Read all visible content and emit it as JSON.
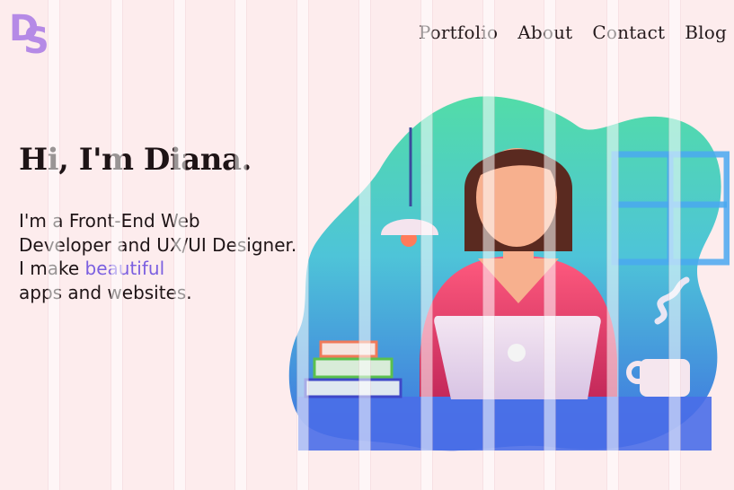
{
  "logo": {
    "letter_1": "D",
    "letter_2": "S"
  },
  "nav": {
    "items": [
      "Portfolio",
      "About",
      "Contact",
      "Blog"
    ]
  },
  "hero": {
    "headline": "Hi, I'm Diana.",
    "line1": "I'm a Front-End Web",
    "line2": "Developer and UX/UI Designer.",
    "line3_prefix": "I make",
    "line3_accent": "beautiful",
    "line4": "apps and websites."
  },
  "colors": {
    "background": "#fdeced",
    "accent": "#7b5fe0",
    "logo": "#b58ae6",
    "text": "#1e1416"
  }
}
